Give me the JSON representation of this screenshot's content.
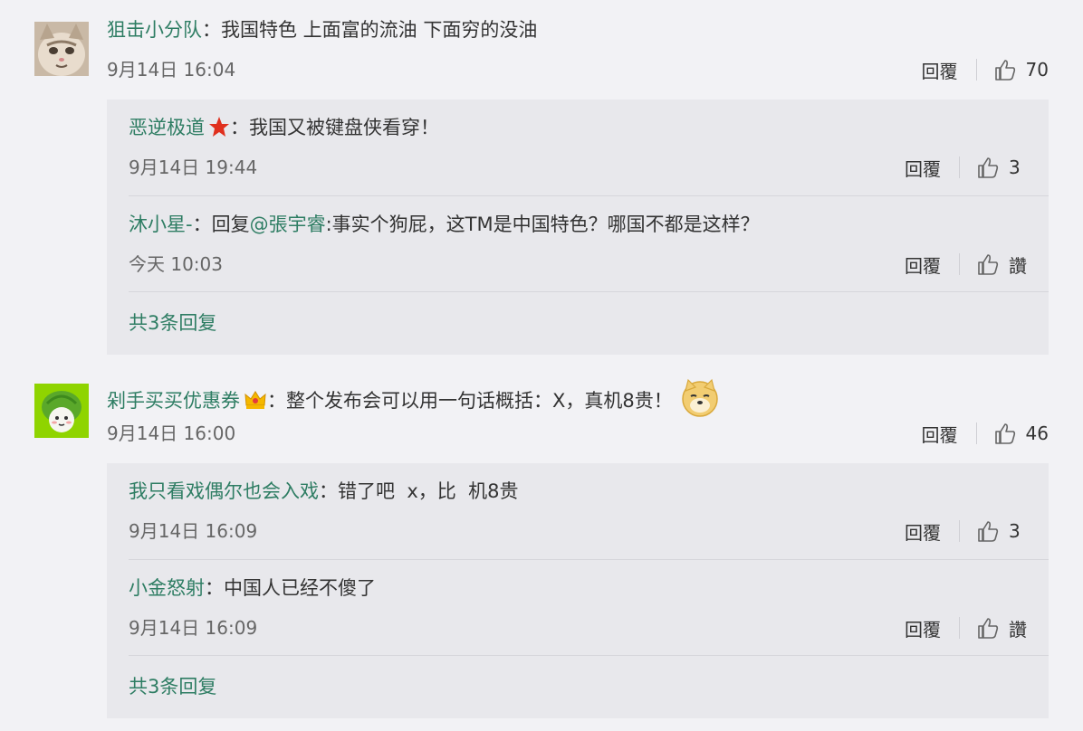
{
  "comments": [
    {
      "user": "狙击小分队",
      "colon": "：",
      "text": "我国特色 上面富的流油 下面穷的没油",
      "date": "9月14日 16:04",
      "reply_label": "回覆",
      "likes": "70",
      "avatar_icon": "cat-avatar",
      "replies": [
        {
          "user": "恶逆极道",
          "badge_icon": "red-star-badge-icon",
          "colon": "：",
          "text": "我国又被键盘侠看穿！",
          "date": "9月14日 19:44",
          "reply_label": "回覆",
          "likes": "3"
        },
        {
          "user": "沐小星-",
          "colon": "：",
          "prefix": "回复",
          "mention": "@張宇睿",
          "text": ":事实个狗屁，这TM是中国特色？哪国不都是这样？",
          "date": "今天 10:03",
          "reply_label": "回覆",
          "likes": "讚"
        }
      ],
      "more_label": "共3条回复"
    },
    {
      "user": "剁手买买优惠券",
      "badge_icon": "crown-badge-icon",
      "colon": "：",
      "text": "整个发布会可以用一句话概括：X，真机8贵！",
      "emoji_icon": "doge-emoji-icon",
      "date": "9月14日 16:00",
      "reply_label": "回覆",
      "likes": "46",
      "avatar_icon": "cabbage-avatar",
      "replies": [
        {
          "user": "我只看戏偶尔也会入戏",
          "colon": "：",
          "text": "错了吧  x，比  机8贵",
          "date": "9月14日 16:09",
          "reply_label": "回覆",
          "likes": "3"
        },
        {
          "user": "小金怒射",
          "colon": "：",
          "text": "中国人已经不傻了",
          "date": "9月14日 16:09",
          "reply_label": "回覆",
          "likes": "讚"
        }
      ],
      "more_label": "共3条回复"
    }
  ],
  "colors": {
    "name": "#2e7d63",
    "text": "#333333",
    "date": "#666666",
    "reply_bg": "#e8e8ec"
  }
}
